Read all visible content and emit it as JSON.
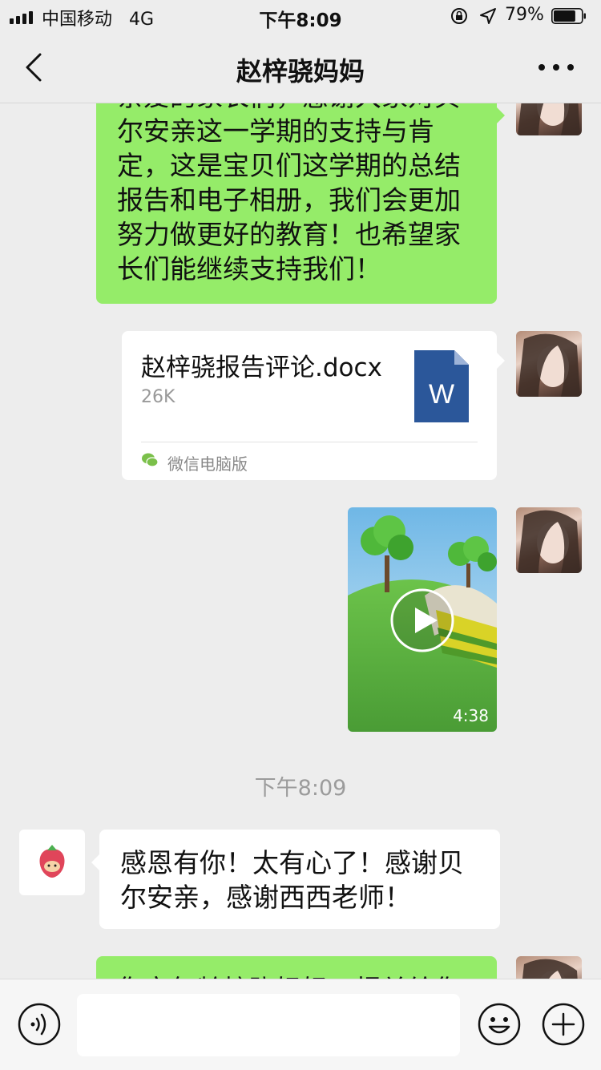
{
  "status_bar": {
    "carrier": "中国移动",
    "network": "4G",
    "time": "下午8:09",
    "battery": "79%",
    "battery_level": 0.79
  },
  "nav": {
    "title": "赵梓骁妈妈",
    "back_icon": "chevron-left-icon",
    "more_icon": "more-dots-icon"
  },
  "messages": [
    {
      "type": "text",
      "side": "right",
      "text": "亲爱的家长们，感谢大家对贝尔安亲这一学期的支持与肯定，这是宝贝们这学期的总结报告和电子相册，我们会更加努力做更好的教育！也希望家长们能继续支持我们！"
    },
    {
      "type": "file",
      "side": "right",
      "file_name": "赵梓骁报告评论.docx",
      "file_size": "26K",
      "file_icon_letter": "W",
      "source": "微信电脑版"
    },
    {
      "type": "video",
      "side": "right",
      "duration": "4:38"
    },
    {
      "type": "text",
      "side": "left",
      "text": "感恩有你！太有心了！感谢贝尔安亲，感谢西西老师！"
    },
    {
      "type": "text",
      "side": "right",
      "text": "您家年龄梓骁妈妈，报关给您"
    }
  ],
  "timestamp": "下午8:09",
  "toolbar": {
    "voice_icon": "voice-icon",
    "input_value": "",
    "emoji_icon": "emoji-icon",
    "plus_icon": "plus-icon"
  },
  "colors": {
    "background": "#ededed",
    "sent_bubble": "#95ec69",
    "received_bubble": "#ffffff",
    "word_blue": "#2b579a"
  }
}
